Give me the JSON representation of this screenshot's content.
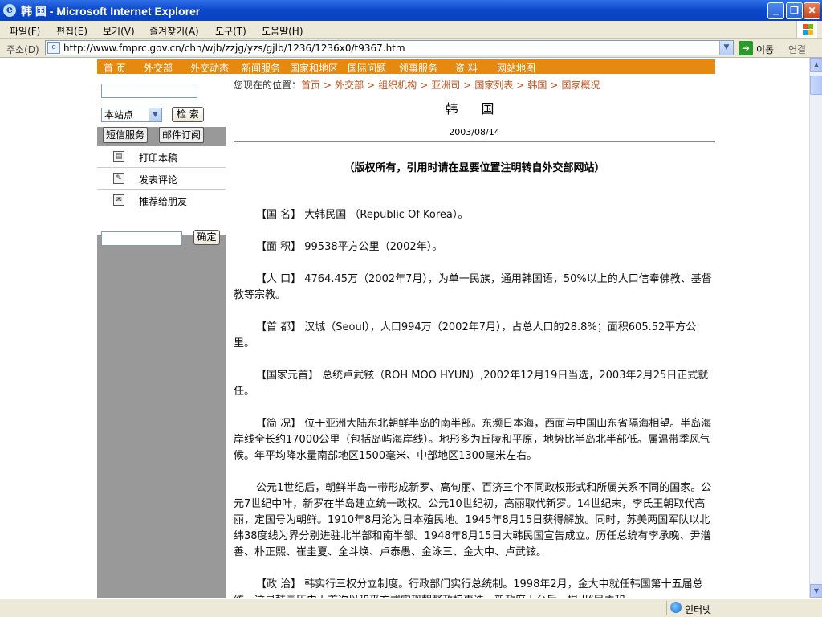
{
  "window": {
    "title": "韩 国 - Microsoft Internet Explorer"
  },
  "menubar": {
    "items": [
      "파일(F)",
      "편집(E)",
      "보기(V)",
      "즐겨찾기(A)",
      "도구(T)",
      "도움말(H)"
    ]
  },
  "addressbar": {
    "label": "주소(D)",
    "url": "http://www.fmprc.gov.cn/chn/wjb/zzjg/yzs/gjlb/1236/1236x0/t9367.htm",
    "go_label": "이동",
    "links_label": "연결"
  },
  "statusbar": {
    "zone": "인터넷"
  },
  "site_nav": {
    "items": [
      "首 页",
      "外交部",
      "外交动态",
      "新闻服务",
      "国家和地区",
      "国际问题",
      "领事服务",
      "资  料",
      "网站地图"
    ]
  },
  "sidebar": {
    "search_scope": "本站点",
    "search_button": "检 索",
    "sms_button": "短信服务",
    "mail_button": "邮件订阅",
    "print": "打印本稿",
    "comment": "发表评论",
    "recommend": "推荐给朋友",
    "confirm_button": "确定"
  },
  "content": {
    "crumb_prefix": "您现在的位置：",
    "crumbs": [
      "首页",
      "外交部",
      "组织机构",
      "亚洲司",
      "国家列表",
      "韩国",
      "国家概况"
    ],
    "title": "韩 国",
    "date": "2003/08/14",
    "copyright": "（版权所有，引用时请在显要位置注明转自外交部网站）",
    "paragraphs": [
      "【国    名】  大韩民国 （Republic Of Korea）。",
      "【面    积】  99538平方公里（2002年）。",
      "【人    口】  4764.45万（2002年7月），为单一民族，通用韩国语，50%以上的人口信奉佛教、基督教等宗教。",
      "【首    都】  汉城（Seoul），人口994万（2002年7月），占总人口的28.8%；面积605.52平方公里。",
      "【国家元首】  总统卢武铉（ROH MOO HYUN）,2002年12月19日当选，2003年2月25日正式就任。",
      "【简    况】  位于亚洲大陆东北朝鲜半岛的南半部。东濒日本海，西面与中国山东省隔海相望。半岛海岸线全长约17000公里（包括岛屿海岸线）。地形多为丘陵和平原，地势比半岛北半部低。属温带季风气候。年平均降水量南部地区1500毫米、中部地区1300毫米左右。",
      "公元1世纪后，朝鲜半岛一带形成新罗、高句丽、百济三个不同政权形式和所属关系不同的国家。公元7世纪中叶，新罗在半岛建立统一政权。公元10世纪初，高丽取代新罗。14世纪末，李氏王朝取代高丽，定国号为朝鲜。1910年8月沦为日本殖民地。1945年8月15日获得解放。同时，苏美两国军队以北纬38度线为界分别进驻北半部和南半部。1948年8月15日大韩民国宣告成立。历任总统有李承晚、尹潽善、朴正熙、崔圭夏、全斗焕、卢泰愚、金泳三、金大中、卢武铉。",
      "【政    治】  韩实行三权分立制度。行政部门实行总统制。1998年2月，金大中就任韩国第十五届总统，这是韩国历史上首次以和平方式实现朝野政权更迭。新政府上台后，提出“民主和"
    ]
  }
}
